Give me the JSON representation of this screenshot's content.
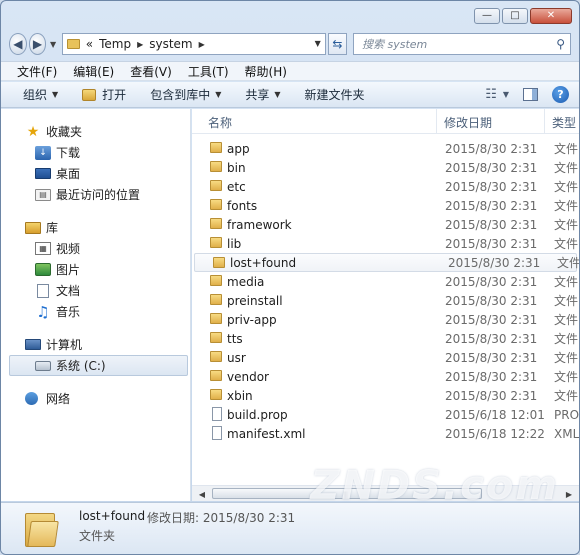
{
  "window": {
    "caption": {
      "minimize": "—",
      "maximize": "□",
      "close": "✕"
    }
  },
  "address": {
    "prefix": "«",
    "segments": [
      "Temp",
      "system"
    ]
  },
  "search": {
    "placeholder": "搜索 system"
  },
  "menu": [
    "文件(F)",
    "编辑(E)",
    "查看(V)",
    "工具(T)",
    "帮助(H)"
  ],
  "toolbar": {
    "organize": "组织",
    "open": "打开",
    "include_library": "包含到库中",
    "share": "共享",
    "new_folder": "新建文件夹"
  },
  "nav": {
    "favorites": {
      "label": "收藏夹",
      "items": [
        "下载",
        "桌面",
        "最近访问的位置"
      ]
    },
    "libraries": {
      "label": "库",
      "items": [
        "视频",
        "图片",
        "文档",
        "音乐"
      ]
    },
    "computer": {
      "label": "计算机",
      "items": [
        "系统 (C:)"
      ]
    },
    "network": {
      "label": "网络"
    }
  },
  "columns": {
    "name": "名称",
    "date": "修改日期",
    "type": "类型"
  },
  "files": [
    {
      "name": "app",
      "date": "2015/8/30 2:31",
      "type": "文件",
      "kind": "folder"
    },
    {
      "name": "bin",
      "date": "2015/8/30 2:31",
      "type": "文件",
      "kind": "folder"
    },
    {
      "name": "etc",
      "date": "2015/8/30 2:31",
      "type": "文件",
      "kind": "folder"
    },
    {
      "name": "fonts",
      "date": "2015/8/30 2:31",
      "type": "文件",
      "kind": "folder"
    },
    {
      "name": "framework",
      "date": "2015/8/30 2:31",
      "type": "文件",
      "kind": "folder"
    },
    {
      "name": "lib",
      "date": "2015/8/30 2:31",
      "type": "文件",
      "kind": "folder"
    },
    {
      "name": "lost+found",
      "date": "2015/8/30 2:31",
      "type": "文件",
      "kind": "folder"
    },
    {
      "name": "media",
      "date": "2015/8/30 2:31",
      "type": "文件",
      "kind": "folder"
    },
    {
      "name": "preinstall",
      "date": "2015/8/30 2:31",
      "type": "文件",
      "kind": "folder"
    },
    {
      "name": "priv-app",
      "date": "2015/8/30 2:31",
      "type": "文件",
      "kind": "folder"
    },
    {
      "name": "tts",
      "date": "2015/8/30 2:31",
      "type": "文件",
      "kind": "folder"
    },
    {
      "name": "usr",
      "date": "2015/8/30 2:31",
      "type": "文件",
      "kind": "folder"
    },
    {
      "name": "vendor",
      "date": "2015/8/30 2:31",
      "type": "文件",
      "kind": "folder"
    },
    {
      "name": "xbin",
      "date": "2015/8/30 2:31",
      "type": "文件",
      "kind": "folder"
    },
    {
      "name": "build.prop",
      "date": "2015/6/18 12:01",
      "type": "PRO",
      "kind": "file"
    },
    {
      "name": "manifest.xml",
      "date": "2015/6/18 12:22",
      "type": "XML",
      "kind": "file"
    }
  ],
  "hovered_row": 6,
  "details": {
    "name": "lost+found",
    "meta": "修改日期: 2015/8/30 2:31",
    "type": "文件夹"
  },
  "watermark": "ZNDS.com"
}
